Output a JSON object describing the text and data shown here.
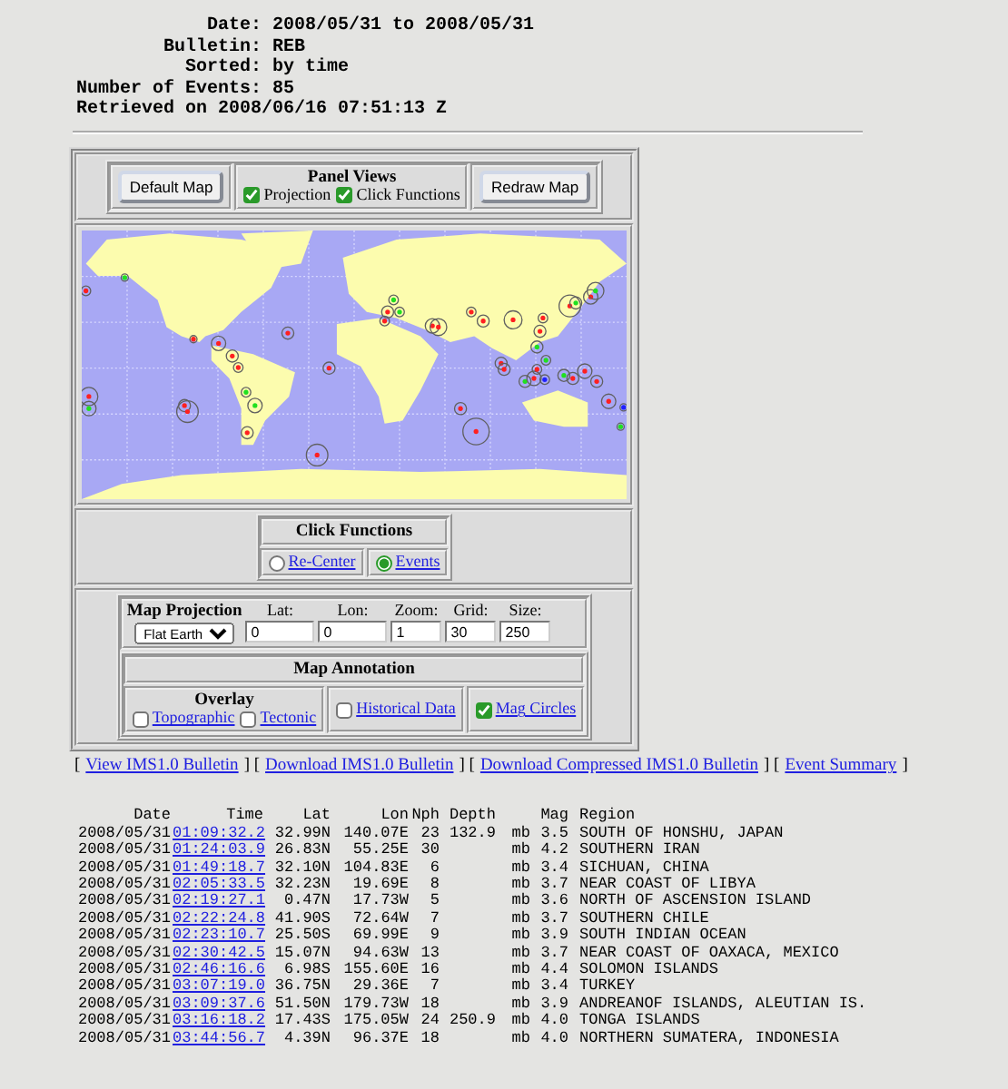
{
  "summary": [
    {
      "label": "Date:",
      "value": "2008/05/31 to 2008/05/31"
    },
    {
      "label": "Bulletin:",
      "value": "REB"
    },
    {
      "label": "Sorted:",
      "value": "by time"
    },
    {
      "label": "Number of Events:",
      "value": "85"
    }
  ],
  "retrieved": "Retrieved on 2008/06/16 07:51:13 Z",
  "panel": {
    "default_button": "Default Map",
    "redraw_button": "Redraw Map",
    "panel_views": {
      "title": "Panel Views",
      "options": [
        {
          "label": "Projection",
          "checked": true
        },
        {
          "label": "Click Functions",
          "checked": true
        }
      ]
    },
    "click_functions": {
      "title": "Click Functions",
      "options": [
        {
          "label": "Re-Center",
          "selected": false
        },
        {
          "label": "Events",
          "selected": true
        }
      ]
    },
    "projection": {
      "label": "Map Projection",
      "select": "Flat Earth",
      "fields": [
        {
          "label": "Lat:",
          "value": "0"
        },
        {
          "label": "Lon:",
          "value": "0"
        },
        {
          "label": "Zoom:",
          "value": "1"
        },
        {
          "label": "Grid:",
          "value": "30"
        },
        {
          "label": "Size:",
          "value": "250"
        }
      ]
    },
    "annotation": {
      "title": "Map Annotation",
      "overlay_title": "Overlay",
      "overlays": [
        {
          "label": "Topographic",
          "checked": false
        },
        {
          "label": "Tectonic",
          "checked": false
        }
      ],
      "options": [
        {
          "label": "Historical Data",
          "checked": false
        },
        {
          "label": "Mag Circles",
          "checked": true
        }
      ]
    }
  },
  "links": [
    {
      "kind": "bracket",
      "text": "["
    },
    {
      "kind": "link",
      "text": "View IMS1.0 Bulletin"
    },
    {
      "kind": "bracket",
      "text": "] ["
    },
    {
      "kind": "link",
      "text": "Download IMS1.0 Bulletin"
    },
    {
      "kind": "bracket",
      "text": "] ["
    },
    {
      "kind": "link",
      "text": "Download Compressed IMS1.0 Bulletin"
    },
    {
      "kind": "bracket",
      "text": "] ["
    },
    {
      "kind": "link",
      "text": "Event Summary"
    },
    {
      "kind": "bracket",
      "text": "]"
    }
  ],
  "events": {
    "columns": [
      "Date",
      "Time",
      "Lat",
      "Lon",
      "Nph",
      "Depth",
      "Mag",
      "Region"
    ],
    "rows": [
      {
        "date": "2008/05/31",
        "time": "01:09:32.2",
        "lat": "32.99N",
        "lon": "140.07E",
        "nph": "23",
        "depth": "132.9",
        "mag_type": "mb",
        "mag": "3.5",
        "region": "SOUTH OF HONSHU, JAPAN"
      },
      {
        "date": "2008/05/31",
        "time": "01:24:03.9",
        "lat": "26.83N",
        "lon": "55.25E",
        "nph": "30",
        "mag_type": "mb",
        "mag": "4.2",
        "region": "SOUTHERN IRAN"
      },
      {
        "date": "2008/05/31",
        "time": "01:49:18.7",
        "lat": "32.10N",
        "lon": "104.83E",
        "nph": "6",
        "mag_type": "mb",
        "mag": "3.4",
        "region": "SICHUAN, CHINA"
      },
      {
        "date": "2008/05/31",
        "time": "02:05:33.5",
        "lat": "32.23N",
        "lon": "19.69E",
        "nph": "8",
        "mag_type": "mb",
        "mag": "3.7",
        "region": "NEAR COAST OF LIBYA"
      },
      {
        "date": "2008/05/31",
        "time": "02:19:27.1",
        "lat": "0.47N",
        "lon": "17.73W",
        "nph": "5",
        "mag_type": "mb",
        "mag": "3.6",
        "region": "NORTH OF ASCENSION ISLAND"
      },
      {
        "date": "2008/05/31",
        "time": "02:22:24.8",
        "lat": "41.90S",
        "lon": "72.64W",
        "nph": "7",
        "mag_type": "mb",
        "mag": "3.7",
        "region": "SOUTHERN CHILE"
      },
      {
        "date": "2008/05/31",
        "time": "02:23:10.7",
        "lat": "25.50S",
        "lon": "69.99E",
        "nph": "9",
        "mag_type": "mb",
        "mag": "3.9",
        "region": "SOUTH INDIAN OCEAN"
      },
      {
        "date": "2008/05/31",
        "time": "02:30:42.5",
        "lat": "15.07N",
        "lon": "94.63W",
        "nph": "13",
        "mag_type": "mb",
        "mag": "3.7",
        "region": "NEAR COAST OF OAXACA, MEXICO"
      },
      {
        "date": "2008/05/31",
        "time": "02:46:16.6",
        "lat": "6.98S",
        "lon": "155.60E",
        "nph": "16",
        "mag_type": "mb",
        "mag": "4.4",
        "region": "SOLOMON ISLANDS"
      },
      {
        "date": "2008/05/31",
        "time": "03:07:19.0",
        "lat": "36.75N",
        "lon": "29.36E",
        "nph": "7",
        "mag_type": "mb",
        "mag": "3.4",
        "region": "TURKEY"
      },
      {
        "date": "2008/05/31",
        "time": "03:09:37.6",
        "lat": "51.50N",
        "lon": "179.73W",
        "nph": "18",
        "mag_type": "mb",
        "mag": "3.9",
        "region": "ANDREANOF ISLANDS, ALEUTIAN IS."
      },
      {
        "date": "2008/05/31",
        "time": "03:16:18.2",
        "lat": "17.43S",
        "lon": "175.05W",
        "nph": "24",
        "depth": "250.9",
        "mag_type": "mb",
        "mag": "4.0",
        "region": "TONGA ISLANDS"
      },
      {
        "date": "2008/05/31",
        "time": "03:44:56.7",
        "lat": "4.39N",
        "lon": "96.37E",
        "nph": "18",
        "mag_type": "mb",
        "mag": "4.0",
        "region": "NORTHERN SUMATERA, INDONESIA"
      }
    ]
  }
}
